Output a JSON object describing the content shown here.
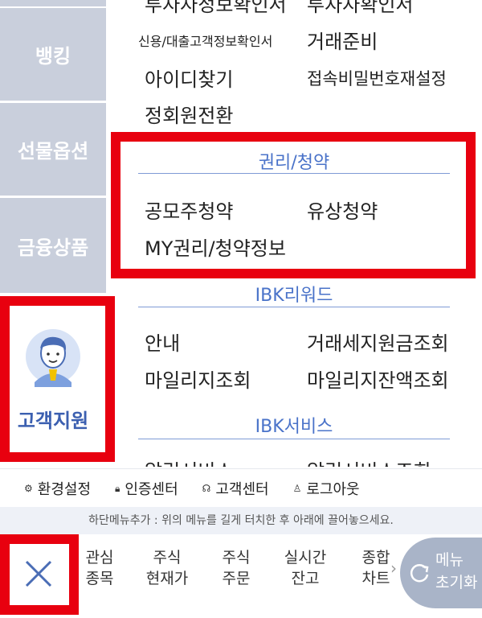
{
  "sidebar": {
    "tabs": [
      {
        "label": "뱅킹"
      },
      {
        "label": "선물옵션"
      },
      {
        "label": "금융상품"
      },
      {
        "label": "고객지원"
      }
    ]
  },
  "menu": {
    "top_items": {
      "a": "투자자정보확인서",
      "b": "투자자확인서",
      "c": "신용/대출고객정보확인서",
      "d": "거래준비",
      "e": "아이디찾기",
      "f": "접속비밀번호재설정",
      "g": "정회원전환"
    },
    "rights": {
      "title": "권리/청약",
      "items": [
        "공모주청약",
        "유상청약",
        "MY권리/청약정보"
      ]
    },
    "reward": {
      "title": "IBK리워드",
      "items": [
        "안내",
        "거래세지원금조회",
        "마일리지조회",
        "마일리지잔액조회"
      ]
    },
    "service": {
      "title": "IBK서비스",
      "items": [
        "알림서비스",
        "알림서비스조회"
      ]
    }
  },
  "utilities": [
    {
      "icon": "gear-icon",
      "label": "환경설정"
    },
    {
      "icon": "lock-icon",
      "label": "인증센터"
    },
    {
      "icon": "headset-icon",
      "label": "고객센터"
    },
    {
      "icon": "user-icon",
      "label": "로그아웃"
    }
  ],
  "hint": "하단메뉴추가 : 위의 메뉴를 길게 터치한 후 아래에 끌어놓으세요.",
  "bottom_menu": [
    {
      "line1": "관심",
      "line2": "종목"
    },
    {
      "line1": "주식",
      "line2": "현재가"
    },
    {
      "line1": "주식",
      "line2": "주문"
    },
    {
      "line1": "실시간",
      "line2": "잔고"
    },
    {
      "line1": "종합",
      "line2": "차트"
    }
  ],
  "reset_button": {
    "line1": "메뉴",
    "line2": "초기화"
  },
  "colors": {
    "highlight": "#e8000f",
    "accent": "#4a73c9",
    "sidebar": "#c9cfdc"
  }
}
